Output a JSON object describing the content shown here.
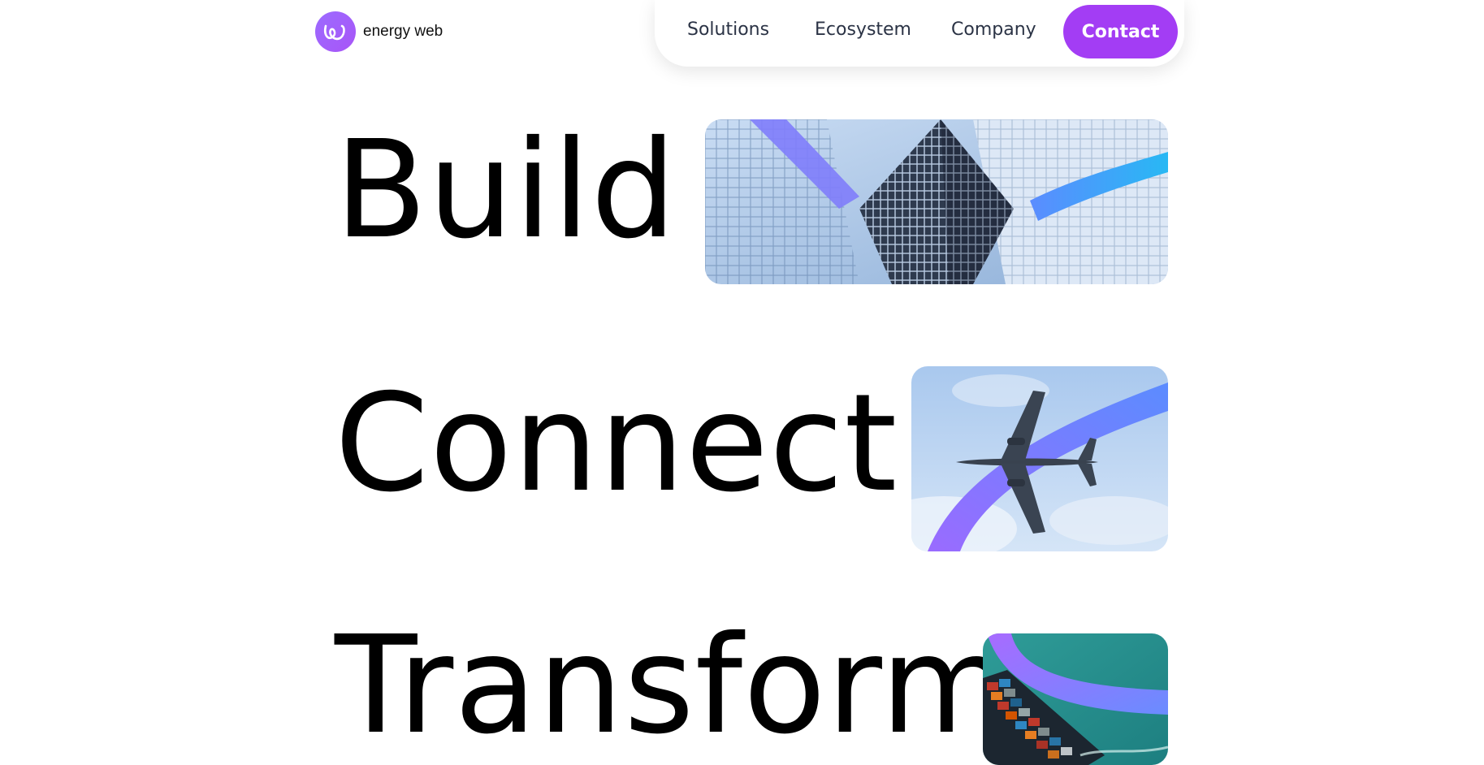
{
  "brand": {
    "name": "energy web",
    "icon": "energy-web-swirl-icon",
    "accent": "#a33df4"
  },
  "nav": {
    "items": [
      {
        "label": "Solutions"
      },
      {
        "label": "Ecosystem"
      },
      {
        "label": "Company"
      }
    ],
    "contact_label": "Contact"
  },
  "hero": {
    "rows": [
      {
        "word": "Build",
        "image": "skyscraper-photo"
      },
      {
        "word": "Connect",
        "image": "airplane-photo"
      },
      {
        "word": "Transform",
        "image": "cargo-ship-photo"
      }
    ]
  }
}
